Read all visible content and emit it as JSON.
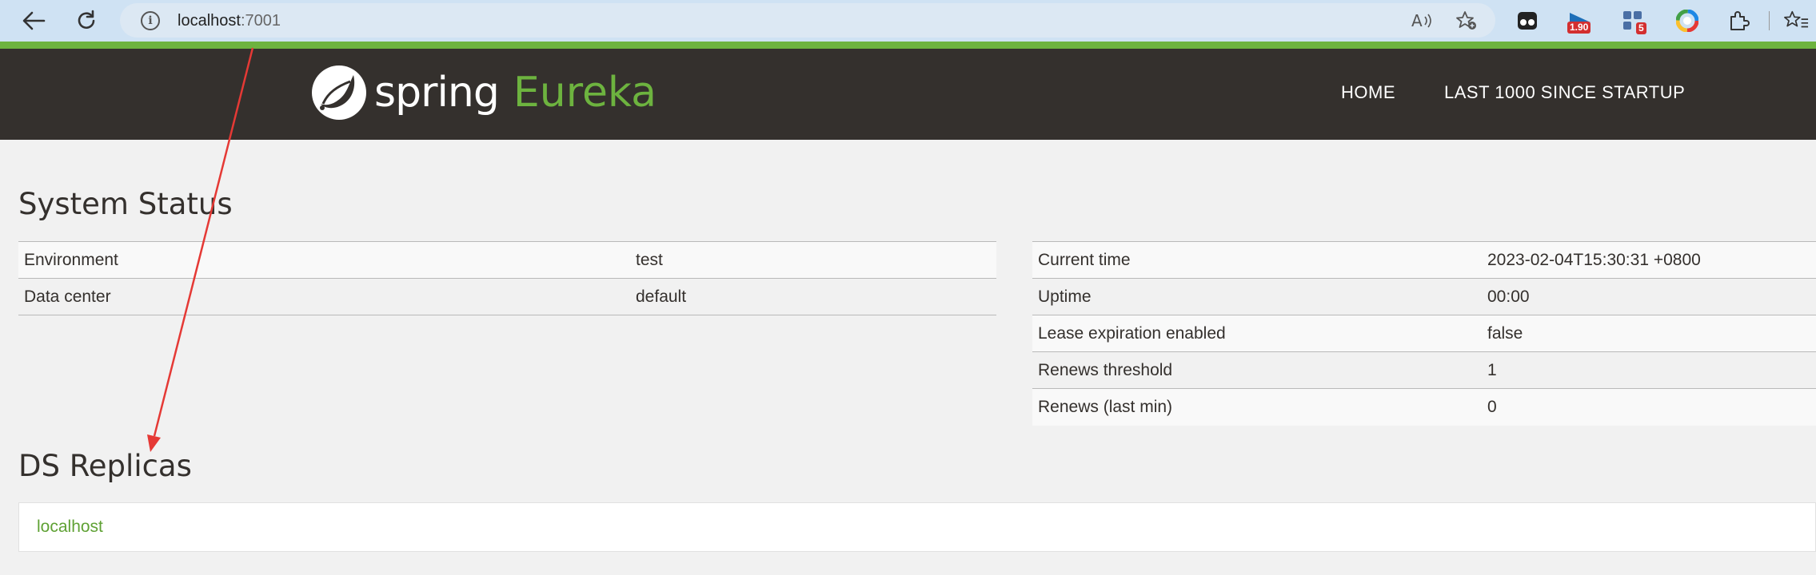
{
  "browser": {
    "url_host": "localhost",
    "url_port": ":7001",
    "extensions": [
      {
        "name": "tampermonkey-icon"
      },
      {
        "name": "flag-extension-icon",
        "badge": "1.90"
      },
      {
        "name": "apps-extension-icon",
        "badge": "5"
      },
      {
        "name": "color-extension-icon"
      },
      {
        "name": "extensions-puzzle-icon"
      }
    ]
  },
  "header": {
    "logo_spring": "spring",
    "logo_eureka": "Eureka",
    "nav": [
      "HOME",
      "LAST 1000 SINCE STARTUP"
    ]
  },
  "system_status": {
    "title": "System Status",
    "left": [
      {
        "label": "Environment",
        "value": "test"
      },
      {
        "label": "Data center",
        "value": "default"
      }
    ],
    "right": [
      {
        "label": "Current time",
        "value": "2023-02-04T15:30:31 +0800"
      },
      {
        "label": "Uptime",
        "value": "00:00"
      },
      {
        "label": "Lease expiration enabled",
        "value": "false"
      },
      {
        "label": "Renews threshold",
        "value": "1"
      },
      {
        "label": "Renews (last min)",
        "value": "0"
      }
    ]
  },
  "ds_replicas": {
    "title": "DS Replicas",
    "items": [
      "localhost"
    ]
  },
  "colors": {
    "header_bg": "#34302d",
    "spring_green": "#6db33f",
    "page_bg": "#f1f1f1",
    "annotation_arrow": "#e53935"
  }
}
